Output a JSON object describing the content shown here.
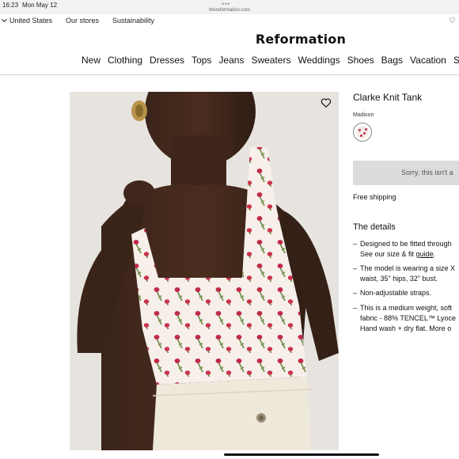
{
  "status_bar": {
    "time": "16:23",
    "date": "Mon May 12",
    "url": "thereformation.com"
  },
  "utility_nav": {
    "country": "United States",
    "stores": "Our stores",
    "sustainability": "Sustainability"
  },
  "brand": {
    "logo": "Reformation"
  },
  "main_nav": [
    "New",
    "Clothing",
    "Dresses",
    "Tops",
    "Jeans",
    "Sweaters",
    "Weddings",
    "Shoes",
    "Bags",
    "Vacation",
    "Sh"
  ],
  "product": {
    "title": "Clarke Knit Tank",
    "color_name": "Madison",
    "cta_label": "Sorry, this isn't a",
    "shipping": "Free shipping"
  },
  "details": {
    "heading": "The details",
    "bullets": [
      {
        "line1": "Designed to be fitted through",
        "line2_pre": "See our size & fit ",
        "line2_link": "guide",
        "line2_post": "."
      },
      {
        "line1": "The model is wearing a size X",
        "line2": "waist, 35\" hips, 32\" bust."
      },
      {
        "line1": "Non-adjustable straps."
      },
      {
        "line1": "This is a medium weight, soft",
        "line2": "fabric - 88% TENCEL™ Lyoce",
        "line3": "Hand wash + dry flat. More o"
      }
    ]
  },
  "icons": {
    "wishlist": "heart-outline-icon",
    "account": "heart-icon"
  },
  "colors": {
    "cta_bg": "#dcdcdc",
    "print_rose": "#c02a4a",
    "print_leaf": "#6c8a45"
  }
}
